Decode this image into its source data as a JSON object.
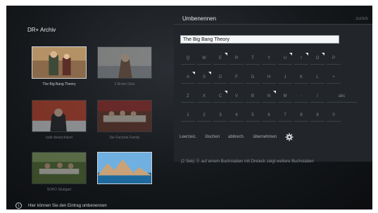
{
  "archive": {
    "title": "DR+ Archiv",
    "tiles": [
      {
        "label": "The Big Bang Theory",
        "dim": false
      },
      {
        "label": "2 Broke Girls",
        "dim": true
      },
      {
        "label": "halb deutschland",
        "dim": true
      },
      {
        "label": "Die Factoria Family",
        "dim": true
      },
      {
        "label": "SOKO Stuttgart",
        "dim": true
      },
      {
        "label": "",
        "dim": false
      }
    ]
  },
  "rename_panel": {
    "title": "Umbenennen",
    "back_label": "zurück",
    "input_value": "The Big Bang Theory",
    "keyboard_rows": [
      [
        "Q",
        "W",
        "E",
        "R",
        "T",
        "Y",
        "U",
        "I",
        "O",
        "P"
      ],
      [
        "A",
        "S",
        "D",
        "F",
        "G",
        "H",
        "J",
        "K",
        "L",
        "+"
      ],
      [
        "Z",
        "X",
        "C",
        "V",
        "B",
        "N",
        "M",
        "-",
        "/",
        "abc"
      ],
      [
        "1",
        "2",
        "3",
        "4",
        "5",
        "6",
        "7",
        "8",
        "9",
        "0"
      ]
    ],
    "keys_with_triangle": [
      "E",
      "U",
      "I",
      "O",
      "A",
      "S",
      "C",
      "N"
    ],
    "function_keys": [
      "Leerzeic.",
      "löschen",
      "abbrech.",
      "übernehmen"
    ],
    "settings_icon": "gear-icon",
    "hint": "(2 Sek) ⓞ auf einem Buchstaben mit Dreieck zeigt weitere Buchstaben"
  },
  "footer": {
    "icon": "info-icon",
    "text": "Hier können Sie den Eintrag umbenennen"
  }
}
